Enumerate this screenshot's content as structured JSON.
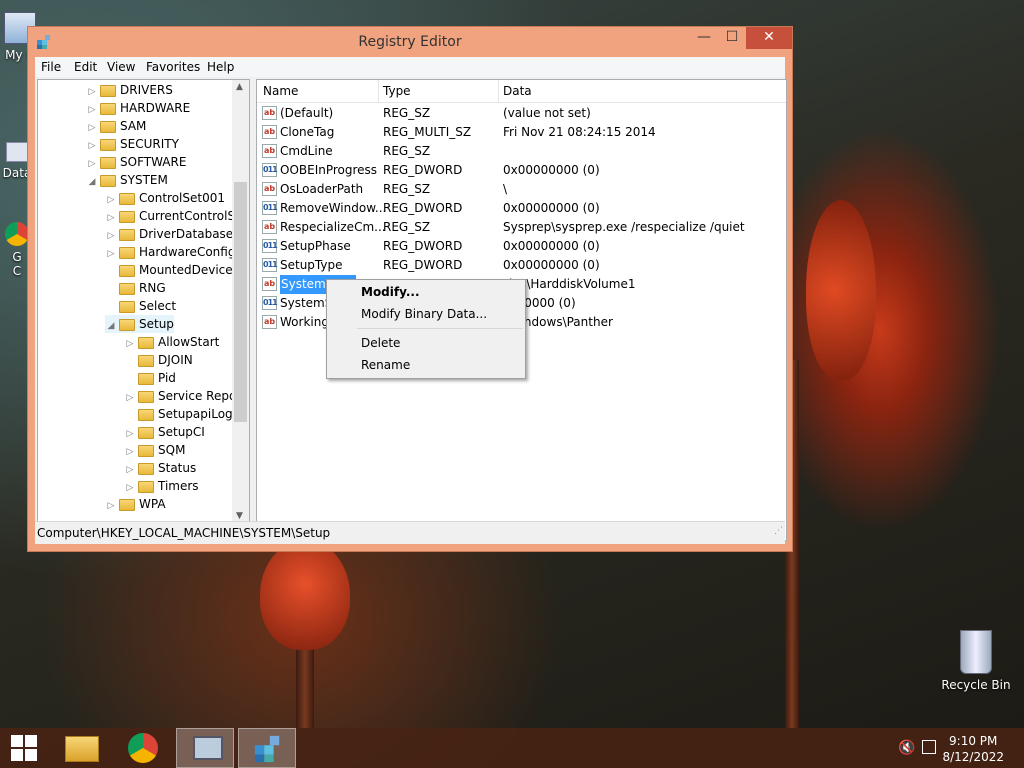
{
  "desktop": {
    "icons": [
      {
        "label": "My C"
      },
      {
        "label": "Data"
      },
      {
        "label": "G\nC"
      },
      {
        "label": "Recycle Bin"
      }
    ]
  },
  "window": {
    "title": "Registry Editor",
    "controls": {
      "minimize": "—",
      "maximize": "☐",
      "close": "✕"
    }
  },
  "menu": [
    "File",
    "Edit",
    "View",
    "Favorites",
    "Help"
  ],
  "tree": [
    {
      "label": "DRIVERS",
      "expander": "▷"
    },
    {
      "label": "HARDWARE",
      "expander": "▷"
    },
    {
      "label": "SAM",
      "expander": "▷"
    },
    {
      "label": "SECURITY",
      "expander": "▷"
    },
    {
      "label": "SOFTWARE",
      "expander": "▷"
    },
    {
      "label": "SYSTEM",
      "expander": "◢"
    },
    {
      "label": "ControlSet001",
      "expander": "▷"
    },
    {
      "label": "CurrentControlSet",
      "expander": "▷"
    },
    {
      "label": "DriverDatabase",
      "expander": "▷"
    },
    {
      "label": "HardwareConfig",
      "expander": "▷"
    },
    {
      "label": "MountedDevices",
      "expander": ""
    },
    {
      "label": "RNG",
      "expander": ""
    },
    {
      "label": "Select",
      "expander": ""
    },
    {
      "label": "Setup",
      "expander": "◢"
    },
    {
      "label": "AllowStart",
      "expander": "▷"
    },
    {
      "label": "DJOIN",
      "expander": ""
    },
    {
      "label": "Pid",
      "expander": ""
    },
    {
      "label": "Service Report",
      "expander": "▷"
    },
    {
      "label": "SetupapiLogSt",
      "expander": ""
    },
    {
      "label": "SetupCI",
      "expander": "▷"
    },
    {
      "label": "SQM",
      "expander": "▷"
    },
    {
      "label": "Status",
      "expander": "▷"
    },
    {
      "label": "Timers",
      "expander": "▷"
    },
    {
      "label": "WPA",
      "expander": "▷"
    }
  ],
  "list": {
    "headers": {
      "name": "Name",
      "type": "Type",
      "data": "Data"
    },
    "rows": [
      {
        "name": "(Default)",
        "type": "REG_SZ",
        "data": "(value not set)",
        "icon": "ab"
      },
      {
        "name": "CloneTag",
        "type": "REG_MULTI_SZ",
        "data": "Fri Nov 21 08:24:15 2014",
        "icon": "ab"
      },
      {
        "name": "CmdLine",
        "type": "REG_SZ",
        "data": "",
        "icon": "ab"
      },
      {
        "name": "OOBEInProgress",
        "type": "REG_DWORD",
        "data": "0x00000000 (0)",
        "icon": "011"
      },
      {
        "name": "OsLoaderPath",
        "type": "REG_SZ",
        "data": "\\",
        "icon": "ab"
      },
      {
        "name": "RemoveWindow...",
        "type": "REG_DWORD",
        "data": "0x00000000 (0)",
        "icon": "011"
      },
      {
        "name": "RespecializeCm...",
        "type": "REG_SZ",
        "data": "Sysprep\\sysprep.exe /respecialize /quiet",
        "icon": "ab"
      },
      {
        "name": "SetupPhase",
        "type": "REG_DWORD",
        "data": "0x00000000 (0)",
        "icon": "011"
      },
      {
        "name": "SetupType",
        "type": "REG_DWORD",
        "data": "0x00000000 (0)",
        "icon": "011"
      },
      {
        "name": "SystemPa",
        "type": "",
        "data": "ice\\HarddiskVolume1",
        "icon": "ab"
      },
      {
        "name": "SystemSe",
        "type": "",
        "data": "000000 (0)",
        "icon": "011"
      },
      {
        "name": "WorkingD",
        "type": "",
        "data": "Windows\\Panther",
        "icon": "ab"
      }
    ]
  },
  "status_path": "Computer\\HKEY_LOCAL_MACHINE\\SYSTEM\\Setup",
  "context_menu": [
    "Modify...",
    "Modify Binary Data...",
    "Delete",
    "Rename"
  ],
  "taskbar": {
    "time": "9:10 PM",
    "date": "8/12/2022"
  },
  "colors": {
    "title_bar": "#f0a37e",
    "close_button": "#c7503c",
    "selection": "#3399ff",
    "taskbar": "#46231499"
  }
}
